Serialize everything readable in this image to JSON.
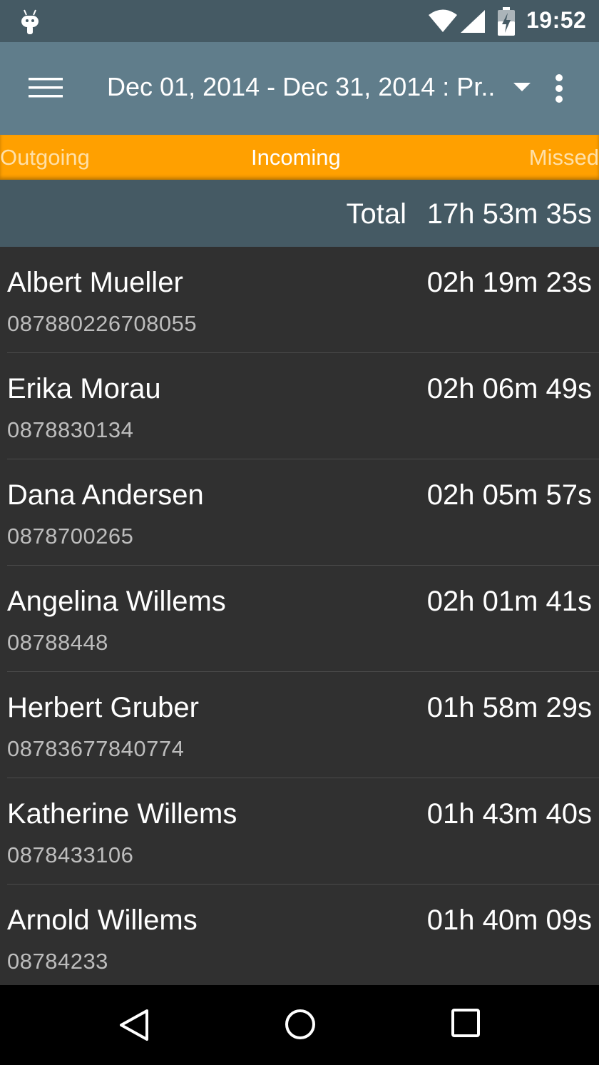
{
  "status_bar": {
    "time": "19:52",
    "icons": [
      "android-icon",
      "wifi-icon",
      "signal-icon",
      "battery-charging-icon"
    ]
  },
  "toolbar": {
    "title": "Dec 01, 2014 - Dec 31, 2014 : Pr..",
    "icons": [
      "menu-icon",
      "dropdown-arrow-icon",
      "more-vert-icon"
    ]
  },
  "tabs": [
    {
      "label": "Outgoing",
      "selected": false
    },
    {
      "label": "Incoming",
      "selected": true
    },
    {
      "label": "Missed",
      "selected": false
    }
  ],
  "accent_color": "#FFA000",
  "total": {
    "label": "Total",
    "value": "17h 53m 35s"
  },
  "calls": [
    {
      "name": "Albert Mueller",
      "number": "087880226708055",
      "duration": "02h 19m 23s"
    },
    {
      "name": "Erika Morau",
      "number": "0878830134",
      "duration": "02h 06m 49s"
    },
    {
      "name": "Dana Andersen",
      "number": "0878700265",
      "duration": "02h 05m 57s"
    },
    {
      "name": "Angelina Willems",
      "number": "08788448",
      "duration": "02h 01m 41s"
    },
    {
      "name": "Herbert Gruber",
      "number": "08783677840774",
      "duration": "01h 58m 29s"
    },
    {
      "name": "Katherine Willems",
      "number": "0878433106",
      "duration": "01h 43m 40s"
    },
    {
      "name": "Arnold Willems",
      "number": "08784233",
      "duration": "01h 40m 09s"
    }
  ],
  "nav_bar": {
    "icons": [
      "back-icon",
      "home-icon",
      "recents-icon"
    ]
  }
}
